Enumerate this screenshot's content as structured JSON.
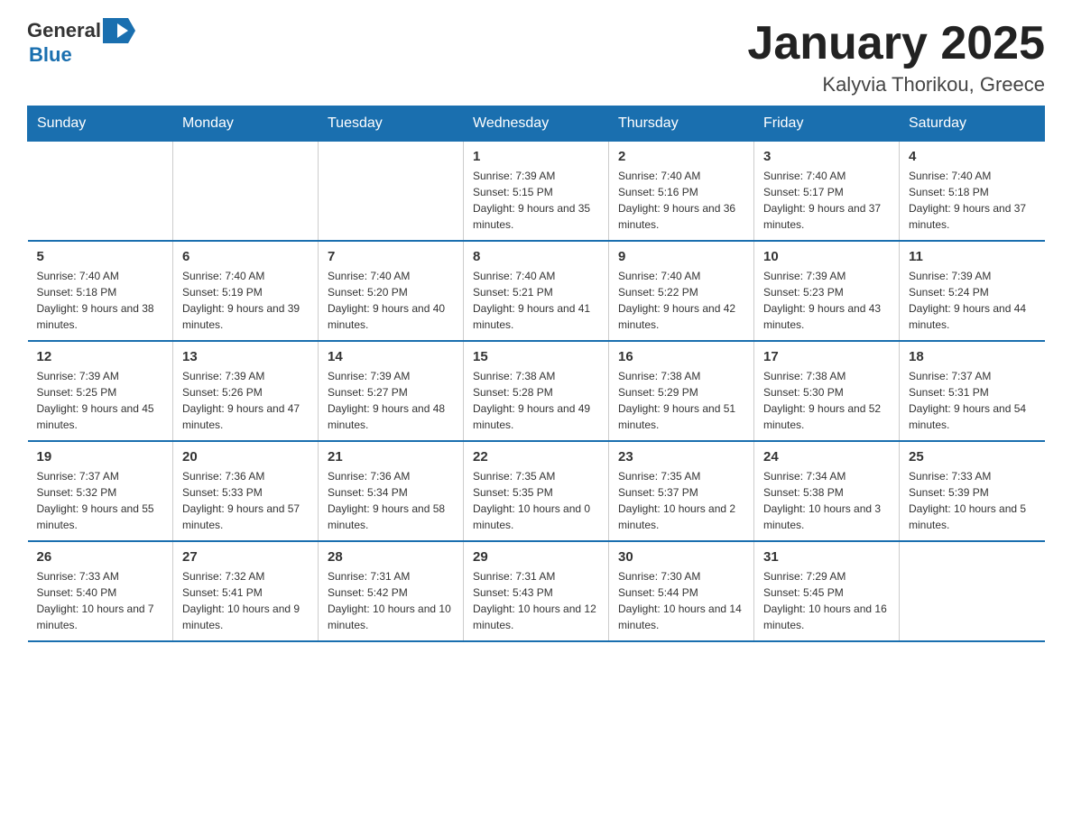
{
  "header": {
    "logo_general": "General",
    "logo_blue": "Blue",
    "month_title": "January 2025",
    "location": "Kalyvia Thorikou, Greece"
  },
  "days_of_week": [
    "Sunday",
    "Monday",
    "Tuesday",
    "Wednesday",
    "Thursday",
    "Friday",
    "Saturday"
  ],
  "weeks": [
    [
      {
        "day": "",
        "info": ""
      },
      {
        "day": "",
        "info": ""
      },
      {
        "day": "",
        "info": ""
      },
      {
        "day": "1",
        "info": "Sunrise: 7:39 AM\nSunset: 5:15 PM\nDaylight: 9 hours and 35 minutes."
      },
      {
        "day": "2",
        "info": "Sunrise: 7:40 AM\nSunset: 5:16 PM\nDaylight: 9 hours and 36 minutes."
      },
      {
        "day": "3",
        "info": "Sunrise: 7:40 AM\nSunset: 5:17 PM\nDaylight: 9 hours and 37 minutes."
      },
      {
        "day": "4",
        "info": "Sunrise: 7:40 AM\nSunset: 5:18 PM\nDaylight: 9 hours and 37 minutes."
      }
    ],
    [
      {
        "day": "5",
        "info": "Sunrise: 7:40 AM\nSunset: 5:18 PM\nDaylight: 9 hours and 38 minutes."
      },
      {
        "day": "6",
        "info": "Sunrise: 7:40 AM\nSunset: 5:19 PM\nDaylight: 9 hours and 39 minutes."
      },
      {
        "day": "7",
        "info": "Sunrise: 7:40 AM\nSunset: 5:20 PM\nDaylight: 9 hours and 40 minutes."
      },
      {
        "day": "8",
        "info": "Sunrise: 7:40 AM\nSunset: 5:21 PM\nDaylight: 9 hours and 41 minutes."
      },
      {
        "day": "9",
        "info": "Sunrise: 7:40 AM\nSunset: 5:22 PM\nDaylight: 9 hours and 42 minutes."
      },
      {
        "day": "10",
        "info": "Sunrise: 7:39 AM\nSunset: 5:23 PM\nDaylight: 9 hours and 43 minutes."
      },
      {
        "day": "11",
        "info": "Sunrise: 7:39 AM\nSunset: 5:24 PM\nDaylight: 9 hours and 44 minutes."
      }
    ],
    [
      {
        "day": "12",
        "info": "Sunrise: 7:39 AM\nSunset: 5:25 PM\nDaylight: 9 hours and 45 minutes."
      },
      {
        "day": "13",
        "info": "Sunrise: 7:39 AM\nSunset: 5:26 PM\nDaylight: 9 hours and 47 minutes."
      },
      {
        "day": "14",
        "info": "Sunrise: 7:39 AM\nSunset: 5:27 PM\nDaylight: 9 hours and 48 minutes."
      },
      {
        "day": "15",
        "info": "Sunrise: 7:38 AM\nSunset: 5:28 PM\nDaylight: 9 hours and 49 minutes."
      },
      {
        "day": "16",
        "info": "Sunrise: 7:38 AM\nSunset: 5:29 PM\nDaylight: 9 hours and 51 minutes."
      },
      {
        "day": "17",
        "info": "Sunrise: 7:38 AM\nSunset: 5:30 PM\nDaylight: 9 hours and 52 minutes."
      },
      {
        "day": "18",
        "info": "Sunrise: 7:37 AM\nSunset: 5:31 PM\nDaylight: 9 hours and 54 minutes."
      }
    ],
    [
      {
        "day": "19",
        "info": "Sunrise: 7:37 AM\nSunset: 5:32 PM\nDaylight: 9 hours and 55 minutes."
      },
      {
        "day": "20",
        "info": "Sunrise: 7:36 AM\nSunset: 5:33 PM\nDaylight: 9 hours and 57 minutes."
      },
      {
        "day": "21",
        "info": "Sunrise: 7:36 AM\nSunset: 5:34 PM\nDaylight: 9 hours and 58 minutes."
      },
      {
        "day": "22",
        "info": "Sunrise: 7:35 AM\nSunset: 5:35 PM\nDaylight: 10 hours and 0 minutes."
      },
      {
        "day": "23",
        "info": "Sunrise: 7:35 AM\nSunset: 5:37 PM\nDaylight: 10 hours and 2 minutes."
      },
      {
        "day": "24",
        "info": "Sunrise: 7:34 AM\nSunset: 5:38 PM\nDaylight: 10 hours and 3 minutes."
      },
      {
        "day": "25",
        "info": "Sunrise: 7:33 AM\nSunset: 5:39 PM\nDaylight: 10 hours and 5 minutes."
      }
    ],
    [
      {
        "day": "26",
        "info": "Sunrise: 7:33 AM\nSunset: 5:40 PM\nDaylight: 10 hours and 7 minutes."
      },
      {
        "day": "27",
        "info": "Sunrise: 7:32 AM\nSunset: 5:41 PM\nDaylight: 10 hours and 9 minutes."
      },
      {
        "day": "28",
        "info": "Sunrise: 7:31 AM\nSunset: 5:42 PM\nDaylight: 10 hours and 10 minutes."
      },
      {
        "day": "29",
        "info": "Sunrise: 7:31 AM\nSunset: 5:43 PM\nDaylight: 10 hours and 12 minutes."
      },
      {
        "day": "30",
        "info": "Sunrise: 7:30 AM\nSunset: 5:44 PM\nDaylight: 10 hours and 14 minutes."
      },
      {
        "day": "31",
        "info": "Sunrise: 7:29 AM\nSunset: 5:45 PM\nDaylight: 10 hours and 16 minutes."
      },
      {
        "day": "",
        "info": ""
      }
    ]
  ]
}
